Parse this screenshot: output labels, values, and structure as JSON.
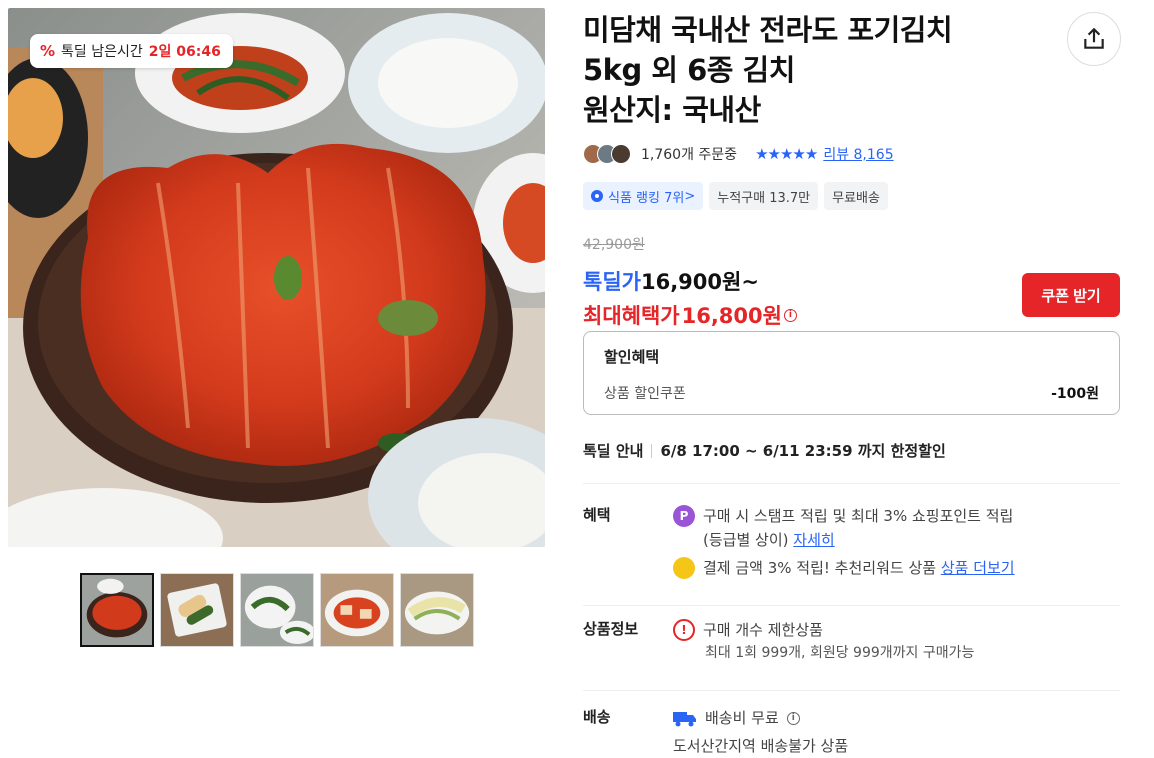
{
  "timer": {
    "percent_icon": "%",
    "label": "톡딜 남은시간",
    "time": "2일 06:46"
  },
  "thumbnails": [
    {
      "name": "kimchi-main",
      "active": true
    },
    {
      "name": "kimchi-roll"
    },
    {
      "name": "green-kimchi"
    },
    {
      "name": "cut-kimchi"
    },
    {
      "name": "white-kimchi"
    }
  ],
  "product": {
    "title_line1": "미담채 국내산 전라도 포기김치",
    "title_line2": "5kg 외 6종 김치",
    "title_line3": "원산지: 국내산",
    "order_count": "1,760개 주문중",
    "stars": "★★★★★",
    "review_label": "리뷰 8,165",
    "tags": {
      "ranking": "식품 랭킹 7위",
      "ranking_chevron": ">",
      "cumulative": "누적구매 13.7만",
      "shipping": "무료배송"
    }
  },
  "price": {
    "original": "42,900원",
    "deal_label": "톡딜가",
    "deal_value": "16,900원~",
    "max_label": "최대혜택가",
    "max_value": "16,800원",
    "info_icon": "i",
    "coupon_button": "쿠폰 받기"
  },
  "discount": {
    "heading": "할인혜택",
    "row_label": "상품 할인쿠폰",
    "row_amount": "-100원"
  },
  "deal_info": {
    "label": "톡딜 안내",
    "value": "6/8 17:00 ~ 6/11 23:59 까지 한정할인"
  },
  "benefits": {
    "label": "혜택",
    "point_icon": "P",
    "line1": "구매 시 스탬프 적립 및 최대 3% 쇼핑포인트 적립",
    "line1_sub": "(등급별 상이)",
    "line1_link": "자세히",
    "line2": "결제 금액 3% 적립! 추천리워드 상품",
    "line2_link": "상품 더보기"
  },
  "product_info": {
    "label": "상품정보",
    "warn_icon": "!",
    "line1": "구매 개수 제한상품",
    "line2": "최대 1회 999개, 회원당 999개까지 구매가능"
  },
  "shipping": {
    "label": "배송",
    "line1": "배송비 무료",
    "line2": "도서산간지역 배송불가 상품"
  },
  "colors": {
    "accent_red": "#e52528",
    "accent_blue": "#2a64f6"
  }
}
